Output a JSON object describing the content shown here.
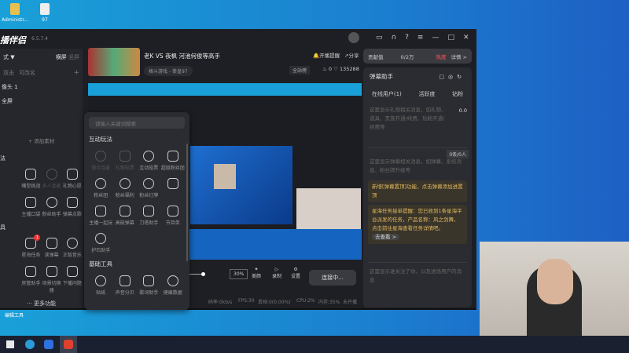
{
  "desktop": {
    "icons": [
      "Administr...",
      "97"
    ],
    "bottom_label": "编辑工具"
  },
  "app": {
    "logo": "播伴侣",
    "version": "6.5.7.4"
  },
  "left": {
    "mode": "式 ▼",
    "orient": [
      "横屏",
      "竖屏"
    ],
    "scene_tabs": [
      "双击",
      "可改名"
    ],
    "add": "+",
    "sources": [
      "像头 1",
      "全屏"
    ],
    "add_material": "+ 添加素材",
    "sec1": "法",
    "sec2": "具",
    "rows": [
      [
        "嘴型挑战",
        "多人连麦",
        "礼物心愿"
      ],
      [
        "主播口袋",
        "粉丝助手",
        "弹幕点歌"
      ],
      [
        "星海任务",
        "读弹幕",
        "正版音乐"
      ],
      [
        "房管助手",
        "场景切换器",
        "下播问题"
      ]
    ],
    "badge": "1",
    "more": "··· 更多功能"
  },
  "popup": {
    "placeholder": "请输入关键词搜索",
    "sec1": "互动玩法",
    "items": [
      "观众连麦",
      "礼物投票",
      "互动投票",
      "超级粉丝团",
      "粉丝团",
      "粉丝福利",
      "粉丝灯牌",
      "",
      "主播一起玩",
      "高能弹幕",
      "刀塔助手",
      "节目单",
      "护石助手"
    ],
    "sec2": "基础工具",
    "tools": [
      "贴纸",
      "声音分贝",
      "歌词助手",
      "健康数据"
    ]
  },
  "header": {
    "title": "老K VS 夜枫 河池何俊等高手",
    "category": "格斗游戏 - 拳皇97",
    "remind": "开播提醒",
    "share": "分享",
    "rank": "全站榜",
    "likes": "0",
    "hearts": "135288"
  },
  "controls": {
    "zoom": "30%",
    "beauty": "美颜",
    "record": "录制",
    "settings": "设置",
    "connect": "连接中..."
  },
  "status": [
    "码率:0kb/s",
    "FPS:30",
    "丢帧:0(0.00%)",
    "CPU:2%",
    "内存:35%",
    "未开播"
  ],
  "right": {
    "contrib": "贡献值",
    "progress": "0/2万",
    "heat": "热度",
    "detail": "详情 >",
    "assistant": "弹幕助手",
    "tabs": [
      "在线用户(1)",
      "活跃度",
      "钻粉"
    ],
    "gift_msg": "这里显示礼物相关消息，如礼物、道具、贵族开通/续费、钻粉开通/续费等",
    "gift_val": "0.0",
    "count": "0条/0人",
    "danmu_msg": "这里显示弹幕相关消息，如弹幕、系统消息、粉丝牌升级等",
    "notice1": "新增[弹幕置顶]功能，点击弹幕添加进置顶",
    "notice2": "星海任务接单提醒：您已收到1条星海平台派发的任务，产品名称：风之剑舞，点击前往星海查看任务详情吧。",
    "go": "去查看 >",
    "follow_msg": "这里显示谁关注了你，以及进场用户的消息"
  }
}
